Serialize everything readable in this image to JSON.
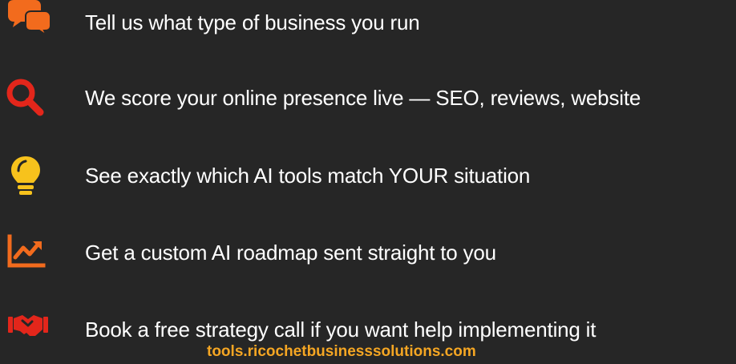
{
  "colors": {
    "background": "#262626",
    "text": "#ffffff",
    "icon_orange": "#f26b1d",
    "icon_red": "#e3261b",
    "icon_yellow": "#f7c21c",
    "link_gold": "#f5a623"
  },
  "steps": [
    {
      "icon": "chat-bubbles-icon",
      "label": "Tell us what type of business you run"
    },
    {
      "icon": "magnifier-icon",
      "label": "We score your online presence live — SEO, reviews, website"
    },
    {
      "icon": "lightbulb-icon",
      "label": "See exactly which AI tools match YOUR situation"
    },
    {
      "icon": "trend-chart-icon",
      "label": "Get a custom AI roadmap sent straight to you"
    },
    {
      "icon": "handshake-icon",
      "label": "Book a free strategy call if you want help implementing it"
    }
  ],
  "footer": {
    "link_text": "tools.ricochetbusinesssolutions.com"
  }
}
